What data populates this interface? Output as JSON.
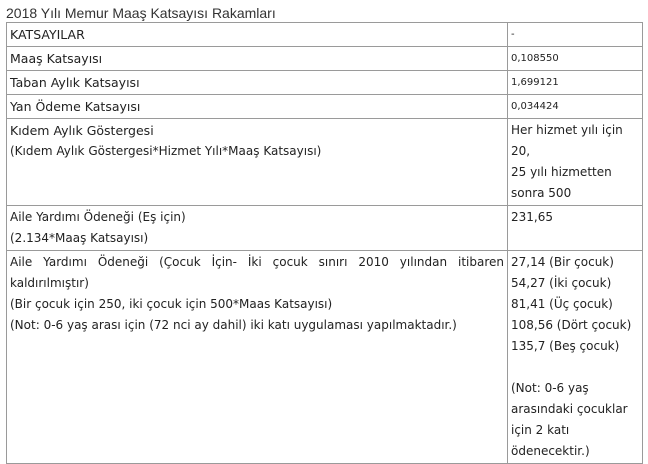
{
  "page_title": "2018 Yılı Memur Maaş Katsayısı Rakamları",
  "header": {
    "label": "KATSAYILAR",
    "value": "-"
  },
  "rows": [
    {
      "label": "Maaş Katsayısı",
      "value": "0,108550"
    },
    {
      "label": "Taban Aylık Katsayısı",
      "value": "1,699121"
    },
    {
      "label": "Yan Ödeme Katsayısı",
      "value": "0,034424"
    }
  ],
  "kidem": {
    "label": "Kıdem Aylık Göstergesi",
    "formula": "(Kıdem Aylık Göstergesi*Hizmet Yılı*Maaş Katsayısı)",
    "value_lines": [
      "Her hizmet yılı için",
      "20,",
      "25 yılı hizmetten",
      "sonra 500"
    ]
  },
  "es": {
    "label": "Aile Yardımı Ödeneği (Eş için)",
    "formula": "(2.134*Maaş Katsayısı)",
    "value": "231,65"
  },
  "cocuk": {
    "label": "Aile Yardımı Ödeneği (Çocuk İçin- İki çocuk sınırı 2010 yılından itibaren kaldırılmıştır)",
    "formula": "(Bir çocuk için 250, iki çocuk için 500*Maas Katsayısı)",
    "note": "(Not: 0-6 yaş arası için (72 nci ay dahil) iki katı uygulaması yapılmaktadır.)",
    "value_lines": [
      "27,14 (Bir çocuk)",
      "54,27 (İki çocuk)",
      "81,41 (Üç çocuk)",
      "108,56 (Dört çocuk)",
      "135,7 (Beş çocuk)"
    ],
    "value_note_lines": [
      "(Not: 0-6 yaş",
      "arasındaki çocuklar",
      "için 2 katı",
      "ödenecektir.)"
    ]
  }
}
